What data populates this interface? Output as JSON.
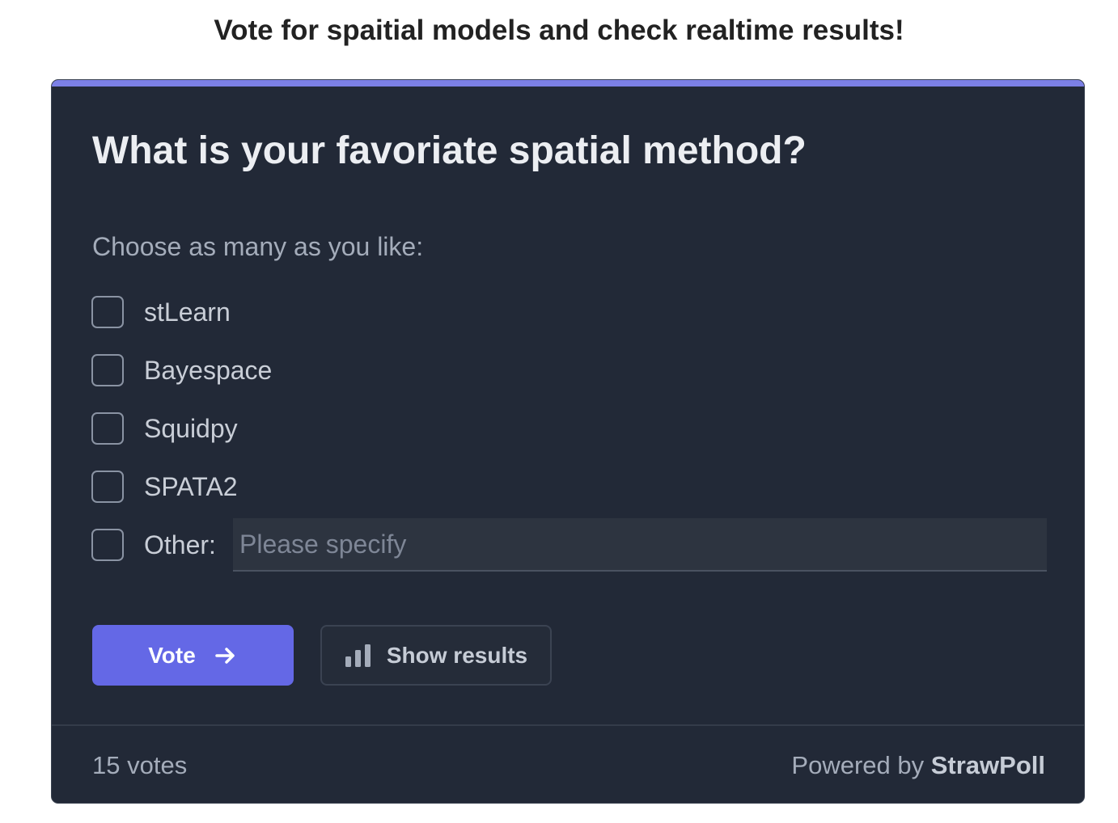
{
  "page": {
    "heading": "Vote for spaitial models and check realtime results!"
  },
  "poll": {
    "question": "What is your favoriate spatial method?",
    "instruction": "Choose as many as you like:",
    "options": [
      {
        "label": "stLearn",
        "checked": false
      },
      {
        "label": "Bayespace",
        "checked": false
      },
      {
        "label": "Squidpy",
        "checked": false
      },
      {
        "label": "SPATA2",
        "checked": false
      },
      {
        "label": "Other:",
        "checked": false
      }
    ],
    "other_input": {
      "placeholder": "Please specify",
      "value": ""
    },
    "vote_button": {
      "label": "Vote",
      "icon": "arrow-right-icon"
    },
    "results_button": {
      "label": "Show results",
      "icon": "bar-chart-icon"
    },
    "footer": {
      "vote_count": "15 votes",
      "powered_prefix": "Powered by",
      "brand": "StrawPoll"
    }
  },
  "colors": {
    "card_background": "#222937",
    "accent_bar": "#7c80e6",
    "vote_button": "#6468e6",
    "text_primary": "#eceef2",
    "text_muted": "#a4acba"
  }
}
